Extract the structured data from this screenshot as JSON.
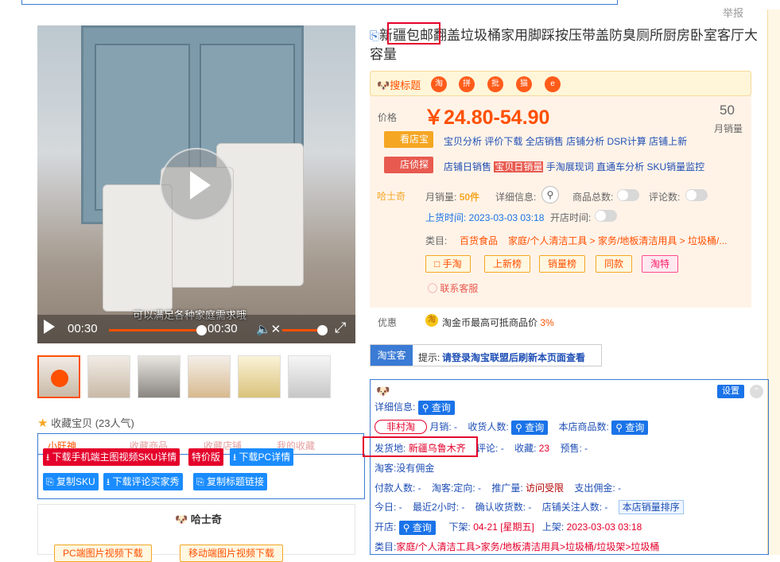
{
  "header": {
    "report_label": "举报"
  },
  "product": {
    "title": "新疆包邮翻盖垃圾桶家用脚踩按压带盖防臭厕所厨房卧室客厅大容量",
    "price_label": "价格",
    "price": "￥24.80-54.90",
    "monthly_sales_value": "50",
    "monthly_sales_label": "月销量"
  },
  "video": {
    "subtitle": "可以满足各种家庭需求哦",
    "time_left": "00:30",
    "time_right": "00:30"
  },
  "search_bar": {
    "label": "搜标题",
    "icons": [
      {
        "name": "taobao-icon",
        "text": "淘"
      },
      {
        "name": "pinduoduo-icon",
        "text": "拼"
      },
      {
        "name": "1688-icon",
        "text": "批"
      },
      {
        "name": "tmall-icon",
        "text": "猫"
      },
      {
        "name": "ebay-icon",
        "text": "e"
      }
    ]
  },
  "shop_tools": {
    "kan_badge": "看店宝",
    "kan_links": [
      "宝贝分析",
      "评价下载",
      "全店销售",
      "店铺分析",
      "DSR计算",
      "店铺上新"
    ],
    "detect_badge": "店侦探",
    "detect_links": [
      "店铺日销售",
      "宝贝日销量",
      "手淘展现词",
      "直通车分析",
      "SKU销量监控"
    ]
  },
  "husky": {
    "label": "哈士奇",
    "monthly_sales_label": "月销量:",
    "monthly_sales_value": "50件",
    "detail_label": "详细信息:",
    "total_products_label": "商品总数:",
    "reviews_label": "评论数:",
    "listed_time": "上货时间: 2023-03-03 03:18",
    "open_time_label": "开店时间:",
    "category_label": "类目:",
    "category_main": "百货食品",
    "category_path": "家庭/个人清洁工具 > 家务/地板清洁用具 > 垃圾桶/...",
    "buttons": [
      "手淘",
      "上新榜",
      "销量榜",
      "同款",
      "淘特"
    ],
    "contact": "联系客服"
  },
  "promo": {
    "label": "优惠",
    "text": "淘金币最高可抵商品价",
    "value": "3%"
  },
  "taobaoke": {
    "tag": "淘宝客",
    "prompt": "提示:",
    "text": "请登录淘宝联盟后刷新本页面查看"
  },
  "info": {
    "settings_label": "设置",
    "query_label": "查询",
    "detail_info_label": "详细信息:",
    "non_village": "非村淘",
    "monthly_sales_label": "月销: -",
    "buyers_label": "收货人数:",
    "shop_products_label": "本店商品数:",
    "ship_from_label": "发货地:",
    "ship_from_value": "新疆乌鲁木齐",
    "reviews_label": "评论: -",
    "favorites_label": "收藏:",
    "favorites_value": "23",
    "presale_label": "预售: -",
    "commission": "淘客:没有佣金",
    "payers_label": "付款人数: -",
    "targeting_label": "淘客:定向: -",
    "promo_volume_label": "推广量:",
    "promo_volume_value": "访问受限",
    "paid_commission_label": "支出佣金: -",
    "today_label": "今日: -",
    "recent2h_label": "最近2小时: -",
    "confirmed_label": "确认收货数: -",
    "followers_label": "店铺关注人数: -",
    "rank_button": "本店销量排序",
    "open_shop_label": "开店:",
    "delist_label": "下架:",
    "delist_value": "04-21 [星期五]",
    "listed_label": "上架:",
    "listed_value": "2023-03-03 03:18",
    "category_label": "类目:",
    "category_value": "家庭/个人清洁工具>家务/地板清洁用具>垃圾桶/垃圾架>垃圾桶"
  },
  "left_panel": {
    "favorite_text": "收藏宝贝 (23人气)",
    "tabs": [
      "小旺神",
      "收藏商品",
      "收藏店铺",
      "我的收藏"
    ],
    "red_buttons": [
      "下载手机端主图视频SKU详情",
      "特价版"
    ],
    "blue_buttons": [
      "下载PC详情",
      "复制SKU",
      "下载评论买家秀",
      "复制标题链接"
    ],
    "husky_title": "哈士奇",
    "husky_buttons": [
      "PC端图片视频下载",
      "移动端图片视频下载"
    ]
  }
}
